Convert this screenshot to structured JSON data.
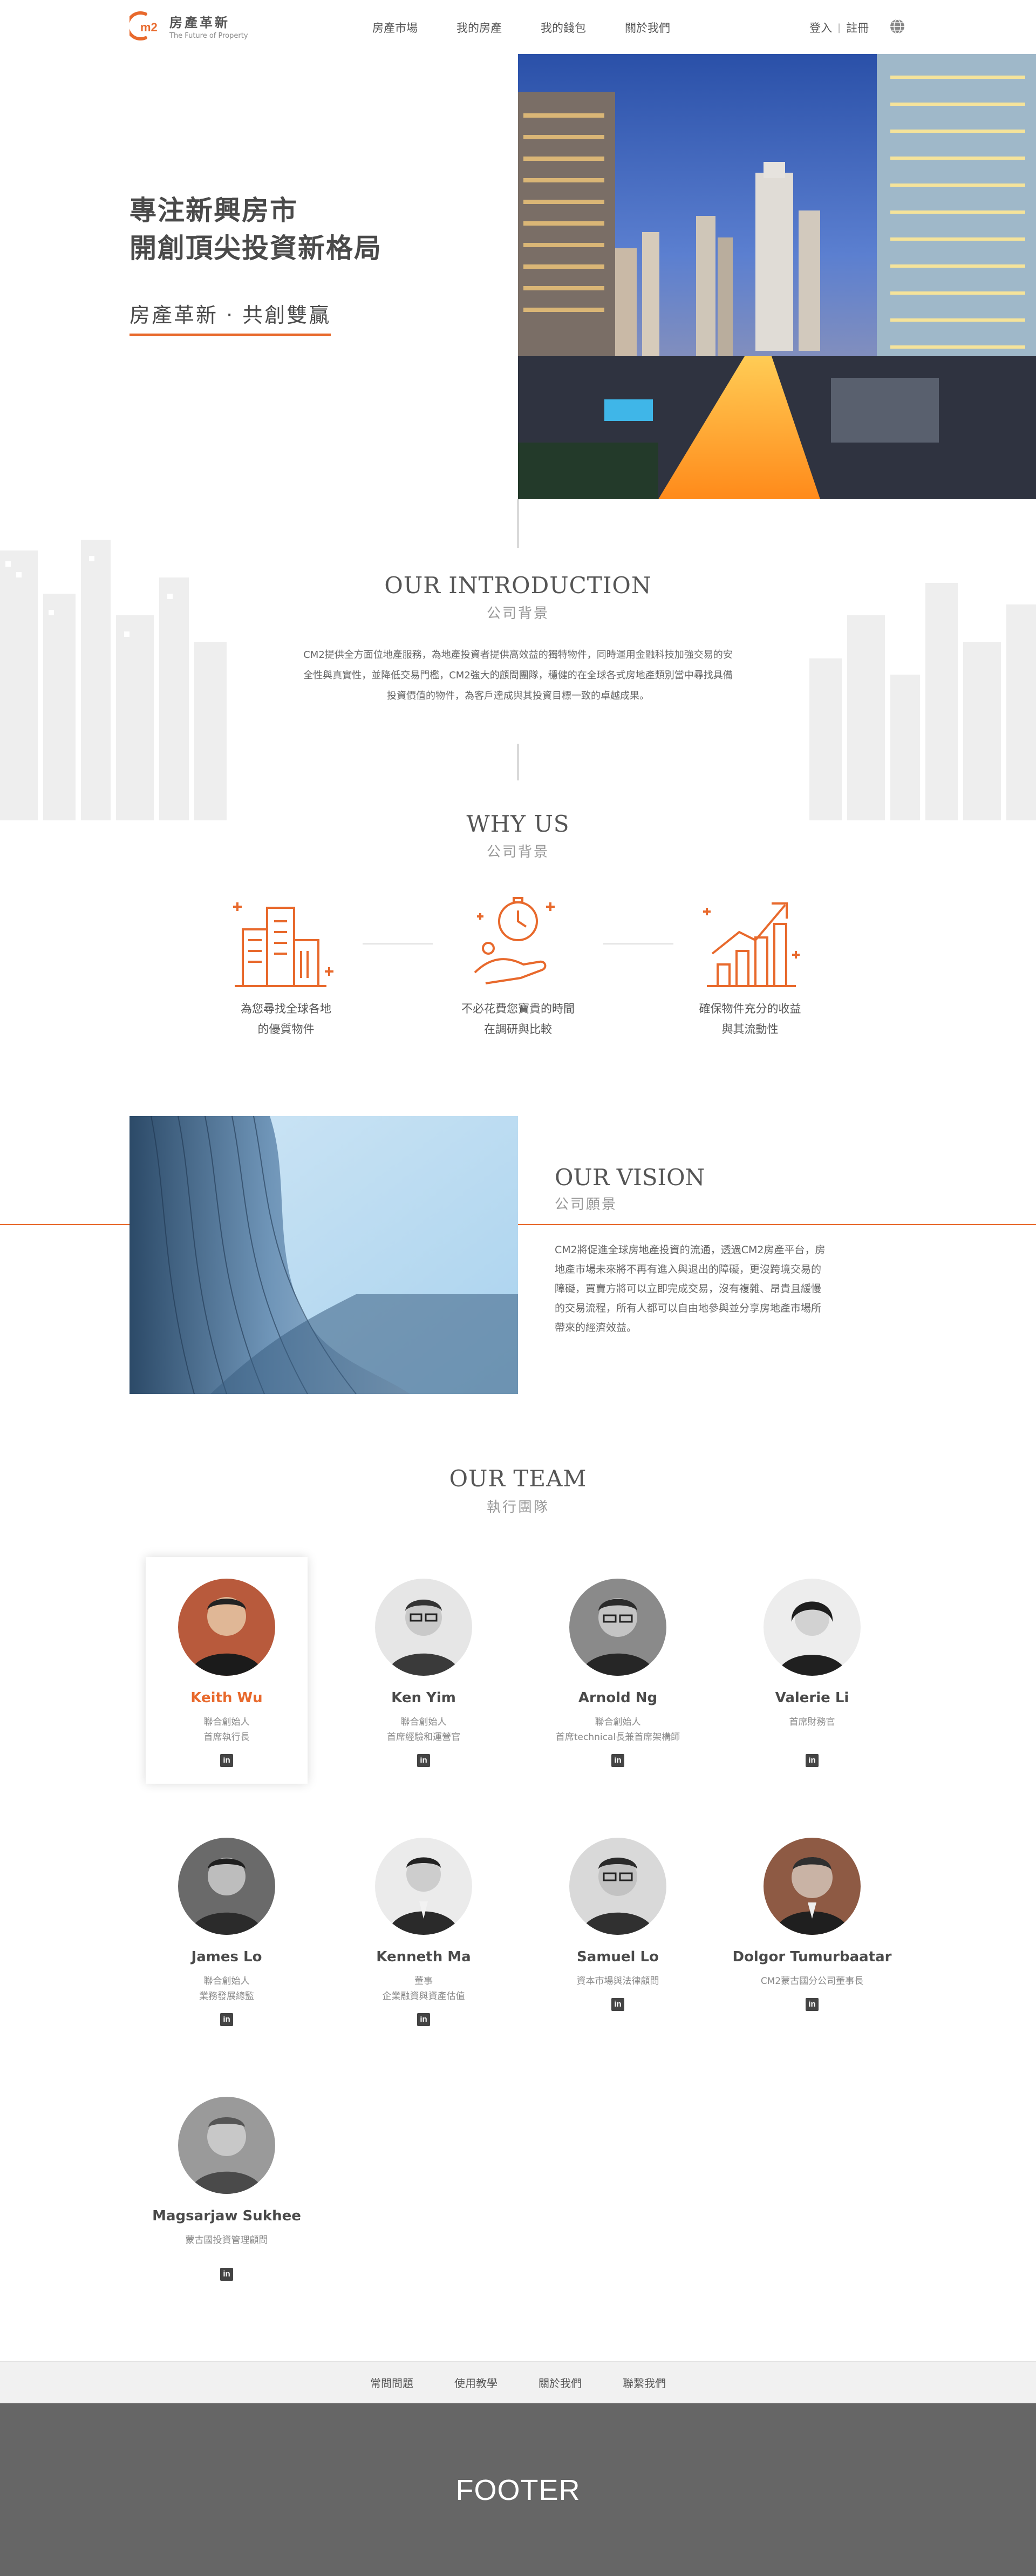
{
  "brand": {
    "logo_mark": "m2",
    "name_cn": "房產革新",
    "tagline_en": "The Future of Property",
    "accent_color": "#e8692c"
  },
  "nav": {
    "items": [
      {
        "label": "房產市場"
      },
      {
        "label": "我的房產"
      },
      {
        "label": "我的錢包"
      },
      {
        "label": "關於我們"
      }
    ],
    "login": "登入",
    "separator": "|",
    "register": "註冊",
    "language_icon": "globe-icon"
  },
  "hero": {
    "title_line1": "專注新興房市",
    "title_line2": "開創頂尖投資新格局",
    "subtitle": "房產革新 · 共創雙贏"
  },
  "introduction": {
    "title": "OUR INTRODUCTION",
    "subtitle": "公司背景",
    "body_line1": "CM2提供全方面位地產服務，為地產投資者提供高效益的獨特物件，同時運用金融科技加強交易的安",
    "body_line2": "全性與真實性，並降低交易門檻，CM2強大的顧問團隊，穩健的在全球各式房地產類別當中尋找具備",
    "body_line3": "投資價值的物件，為客戶達成與其投資目標一致的卓越成果。"
  },
  "why_us": {
    "title": "WHY US",
    "subtitle": "公司背景",
    "items": [
      {
        "icon": "buildings-icon",
        "line1": "為您尋找全球各地",
        "line2": "的優質物件"
      },
      {
        "icon": "time-money-icon",
        "line1": "不必花費您寶貴的時間",
        "line2": "在調研與比較"
      },
      {
        "icon": "growth-chart-icon",
        "line1": "確保物件充分的收益",
        "line2": "與其流動性"
      }
    ]
  },
  "vision": {
    "title": "OUR VISION",
    "subtitle": "公司願景",
    "body_line1": "CM2將促進全球房地產投資的流通，透過CM2房產平台，房",
    "body_line2": "地產市場未來將不再有進入與退出的障礙，更沒跨境交易的",
    "body_line3": "障礙，買賣方將可以立即完成交易，沒有複雜、昂貴且緩慢",
    "body_line4": "的交易流程，所有人都可以自由地參與並分享房地產市場所",
    "body_line5": "帶來的經濟效益。"
  },
  "team": {
    "title": "OUR TEAM",
    "subtitle": "執行團隊",
    "linkedin_label": "in",
    "members": [
      {
        "name": "Keith Wu",
        "role1": "聯合創始人",
        "role2": "首席執行長"
      },
      {
        "name": "Ken Yim",
        "role1": "聯合創始人",
        "role2": "首席經驗和運營官"
      },
      {
        "name": "Arnold Ng",
        "role1": "聯合創始人",
        "role2": "首席technical長兼首席架構師"
      },
      {
        "name": "Valerie Li",
        "role1": "首席財務官",
        "role2": ""
      },
      {
        "name": "James Lo",
        "role1": "聯合創始人",
        "role2": "業務發展總監"
      },
      {
        "name": "Kenneth Ma",
        "role1": "董事",
        "role2": "企業融資與資產估值"
      },
      {
        "name": "Samuel Lo",
        "role1": "資本市場與法律顧問",
        "role2": ""
      },
      {
        "name": "Dolgor Tumurbaatar",
        "role1": "CM2蒙古國分公司董事長",
        "role2": ""
      },
      {
        "name": "Magsarjaw Sukhee",
        "role1": "蒙古國投資管理顧問",
        "role2": ""
      }
    ]
  },
  "footer": {
    "links": [
      {
        "label": "常問問題"
      },
      {
        "label": "使用教學"
      },
      {
        "label": "關於我們"
      },
      {
        "label": "聯繫我們"
      }
    ],
    "label": "FOOTER"
  }
}
